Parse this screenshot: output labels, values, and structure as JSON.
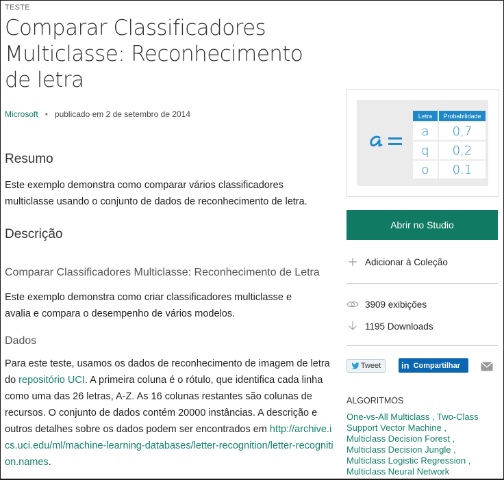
{
  "category": "TESTE",
  "title": "Comparar Classificadores Multiclasse: Reconhecimento de letra",
  "meta": {
    "author": "Microsoft",
    "separator": "•",
    "published": "publicado em 2 de setembro de 2014"
  },
  "resumo": {
    "heading": "Resumo",
    "text": "Este exemplo demonstra como comparar vários classificadores multiclasse usando o conjunto de dados de reconhecimento de letra."
  },
  "descricao": {
    "heading": "Descrição",
    "subheading": "Comparar Classificadores Multiclasse: Reconhecimento de Letra",
    "text": "Este exemplo demonstra como criar classificadores multiclasse e avalia e compara o desempenho de vários modelos."
  },
  "dados": {
    "heading": "Dados",
    "text_before_link": "Para este teste, usamos os dados de reconhecimento de imagem de letra do ",
    "link_repo": "repositório UCI",
    "text_after_link": ". A primeira coluna é o rótulo, que identifica cada linha como uma das 26 letras, A-Z. As 16 colunas restantes são colunas de recursos. O conjunto de dados contém 20000 instâncias. A descrição e outros detalhes sobre os dados podem ser encontrados em ",
    "link_url": "http://archive.ics.uci.edu/ml/machine-learning-databases/letter-recognition/letter-recognition.names",
    "text_end": "."
  },
  "thumbnail": {
    "col_letter": "Letra",
    "col_prob": "Probabilidade",
    "rows": [
      {
        "letter": "a",
        "prob": "0,7"
      },
      {
        "letter": "q",
        "prob": "0,2"
      },
      {
        "letter": "o",
        "prob": "0.1"
      }
    ],
    "accent": "#1e88c9"
  },
  "sidebar": {
    "open_button": "Abrir no Studio",
    "add_collection": "Adicionar à Coleção",
    "views": "3909 exibições",
    "downloads": "1195 Downloads",
    "tweet": "Tweet",
    "share": "Compartilhar",
    "algorithms_title": "ALGORITMOS",
    "algorithms": [
      "One-vs-All Multiclass",
      "Two-Class Support Vector Machine",
      "Multiclass Decision Forest",
      "Multiclass Decision Jungle",
      "Multiclass Logistic Regression",
      "Multiclass Neural Network"
    ],
    "accent": "#117a63"
  }
}
